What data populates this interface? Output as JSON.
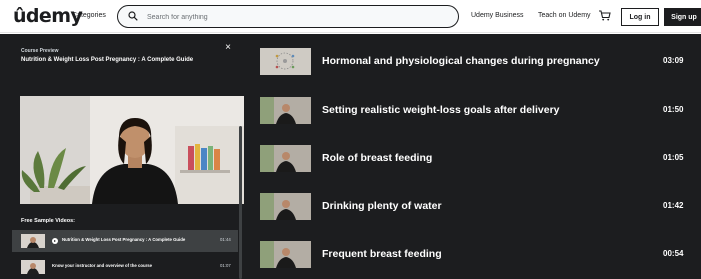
{
  "header": {
    "logo": "ûdemy",
    "categories": "Categories",
    "search_placeholder": "Search for anything",
    "udemy_business": "Udemy Business",
    "teach": "Teach on Udemy",
    "login": "Log in",
    "signup": "Sign up"
  },
  "preview": {
    "eyebrow": "Course Preview",
    "title": "Nutrition & Weight Loss Post Pregnancy : A Complete Guide",
    "close": "×",
    "free_samples_label": "Free Sample Videos:",
    "samples": [
      {
        "title": "Nutrition & Weight Loss Post Pregnancy : A Complete Guide",
        "duration": "01:44",
        "active": true
      },
      {
        "title": "Know your instructor and overview of the course",
        "duration": "01:07",
        "active": false
      }
    ]
  },
  "lectures": [
    {
      "title": "Hormonal and physiological changes during pregnancy",
      "duration": "03:09"
    },
    {
      "title": "Setting realistic weight-loss goals after delivery",
      "duration": "01:50"
    },
    {
      "title": "Role of breast feeding",
      "duration": "01:05"
    },
    {
      "title": "Drinking plenty of water",
      "duration": "01:42"
    },
    {
      "title": "Frequent breast feeding",
      "duration": "00:54"
    }
  ],
  "colors": {
    "brand": "#a435f0",
    "dark_bg": "#1c1d1f",
    "active_row": "#3e4143"
  },
  "icons": [
    "search-icon",
    "cart-icon",
    "close-icon",
    "play-icon"
  ]
}
